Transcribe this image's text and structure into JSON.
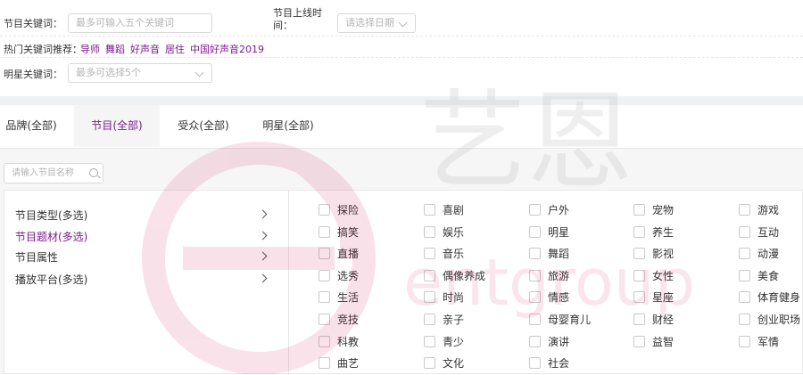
{
  "filters": {
    "keyword_label": "节目关键词：",
    "keyword_placeholder": "最多可输入五个关键词",
    "online_time_label_1": "节目上线时",
    "online_time_label_2": "间：",
    "date_placeholder": "请选择日期",
    "hot_label": "热门关键词推荐：",
    "hot_keywords": [
      "导师",
      "舞蹈",
      "好声音",
      "居住",
      "中国好声音2019"
    ],
    "star_label": "明星关键词：",
    "star_placeholder": "最多可选择5个"
  },
  "tabs": [
    {
      "label": "品牌(全部)",
      "active": false
    },
    {
      "label": "节目(全部)",
      "active": true
    },
    {
      "label": "受众(全部)",
      "active": false
    },
    {
      "label": "明星(全部)",
      "active": false
    }
  ],
  "search": {
    "placeholder": "请输入节目名称"
  },
  "side_menu": [
    {
      "label": "节目类型(多选)",
      "active": false
    },
    {
      "label": "节目题材(多选)",
      "active": true
    },
    {
      "label": "节目属性",
      "active": false
    },
    {
      "label": "播放平台(多选)",
      "active": false
    }
  ],
  "options": [
    [
      "探险",
      "喜剧",
      "户外",
      "宠物",
      "游戏"
    ],
    [
      "搞笑",
      "娱乐",
      "明星",
      "养生",
      "互动"
    ],
    [
      "直播",
      "音乐",
      "舞蹈",
      "影视",
      "动漫"
    ],
    [
      "选秀",
      "偶像养成",
      "旅游",
      "女性",
      "美食"
    ],
    [
      "生活",
      "时尚",
      "情感",
      "星座",
      "体育健身"
    ],
    [
      "竞技",
      "亲子",
      "母婴育儿",
      "财经",
      "创业职场"
    ],
    [
      "科教",
      "青少",
      "演讲",
      "益智",
      "军情"
    ],
    [
      "曲艺",
      "文化",
      "社会"
    ]
  ],
  "watermark": {
    "text": "艺恩",
    "sub": "entgroup"
  },
  "colors": {
    "accent": "#7b1b8e",
    "band": "#eef2f5"
  }
}
